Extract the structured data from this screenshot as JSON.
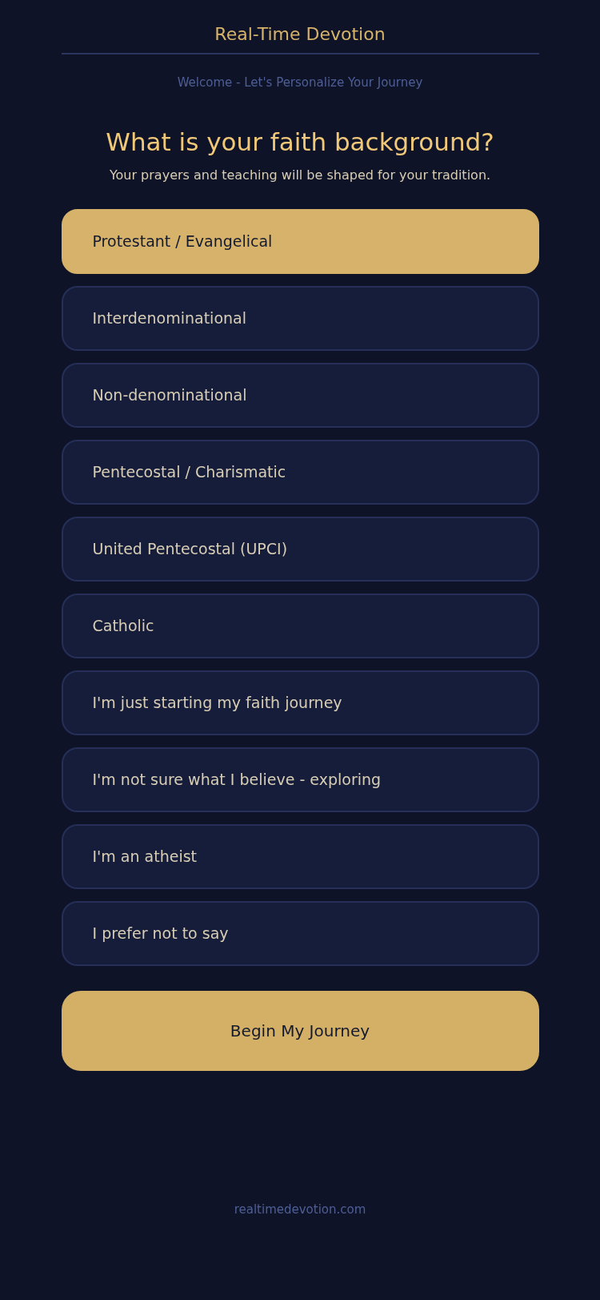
{
  "header": {
    "title": "Real-Time Devotion",
    "subtitle": "Welcome - Let's Personalize Your Journey"
  },
  "question": {
    "title": "What is your faith background?",
    "description": "Your prayers and teaching will be shaped for your tradition."
  },
  "options": [
    {
      "label": "Protestant / Evangelical",
      "selected": true
    },
    {
      "label": "Interdenominational",
      "selected": false
    },
    {
      "label": "Non-denominational",
      "selected": false
    },
    {
      "label": "Pentecostal / Charismatic",
      "selected": false
    },
    {
      "label": "United Pentecostal (UPCI)",
      "selected": false
    },
    {
      "label": "Catholic",
      "selected": false
    },
    {
      "label": "I'm just starting my faith journey",
      "selected": false
    },
    {
      "label": "I'm not sure what I believe - exploring",
      "selected": false
    },
    {
      "label": "I'm an atheist",
      "selected": false
    },
    {
      "label": "I prefer not to say",
      "selected": false
    }
  ],
  "primary_button": "Begin My Journey",
  "footer": "realtimedevotion.com"
}
